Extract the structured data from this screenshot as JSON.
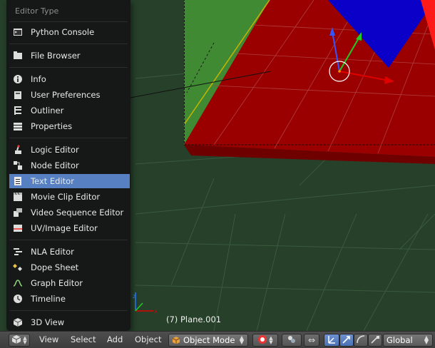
{
  "editor_type_menu": {
    "title": "Editor Type",
    "items": [
      {
        "label": "Python Console",
        "icon": "python-console-icon"
      },
      {
        "label": "File Browser",
        "icon": "file-browser-icon"
      },
      {
        "label": "Info",
        "icon": "info-icon"
      },
      {
        "label": "User Preferences",
        "icon": "user-preferences-icon"
      },
      {
        "label": "Outliner",
        "icon": "outliner-icon"
      },
      {
        "label": "Properties",
        "icon": "properties-icon"
      },
      {
        "label": "Logic Editor",
        "icon": "logic-editor-icon"
      },
      {
        "label": "Node Editor",
        "icon": "node-editor-icon"
      },
      {
        "label": "Text Editor",
        "icon": "text-editor-icon",
        "active": true
      },
      {
        "label": "Movie Clip Editor",
        "icon": "movie-clip-editor-icon"
      },
      {
        "label": "Video Sequence Editor",
        "icon": "video-sequence-editor-icon"
      },
      {
        "label": "UV/Image Editor",
        "icon": "uv-image-editor-icon"
      },
      {
        "label": "NLA Editor",
        "icon": "nla-editor-icon"
      },
      {
        "label": "Dope Sheet",
        "icon": "dope-sheet-icon"
      },
      {
        "label": "Graph Editor",
        "icon": "graph-editor-icon"
      },
      {
        "label": "Timeline",
        "icon": "timeline-icon"
      },
      {
        "label": "3D View",
        "icon": "3d-view-icon"
      }
    ]
  },
  "viewport": {
    "object_readout": "(7) Plane.001"
  },
  "header": {
    "menus": [
      "View",
      "Select",
      "Add",
      "Object"
    ],
    "mode": "Object Mode",
    "transform_orientation": "Global"
  },
  "colors": {
    "viewport_bg": "#26402a",
    "plane_red": "#9a0000",
    "menu_active": "#5680c2",
    "cone_blue": "#0a00c8"
  }
}
